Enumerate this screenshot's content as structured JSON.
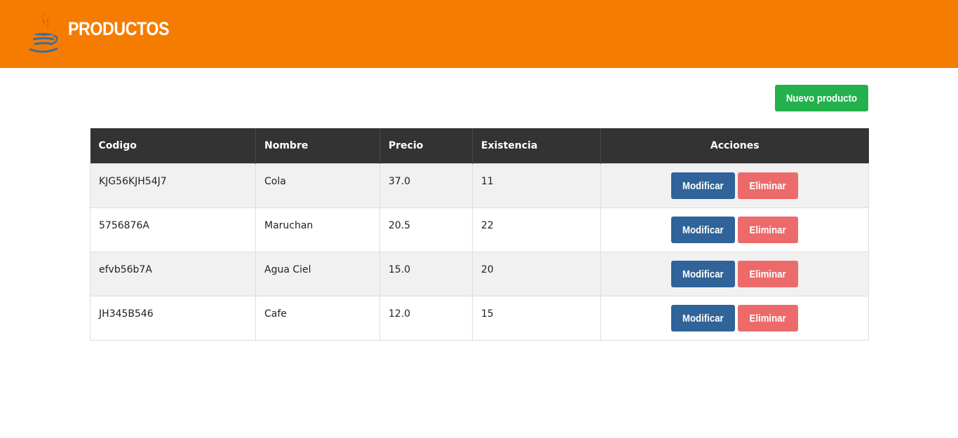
{
  "header": {
    "title": "PRODUCTOS",
    "logo_icon": "java-coffee-cup-icon",
    "background_color": "#f57c00"
  },
  "toolbar": {
    "new_product_label": "Nuevo producto",
    "new_product_color": "#22b14c"
  },
  "table": {
    "columns": [
      "Codigo",
      "Nombre",
      "Precio",
      "Existencia",
      "Acciones"
    ],
    "rows": [
      {
        "codigo": "KJG56KJH54J7",
        "nombre": "Cola",
        "precio": "37.0",
        "existencia": "11"
      },
      {
        "codigo": "5756876A",
        "nombre": "Maruchan",
        "precio": "20.5",
        "existencia": "22"
      },
      {
        "codigo": "efvb56b7A",
        "nombre": "Agua Ciel",
        "precio": "15.0",
        "existencia": "20"
      },
      {
        "codigo": "JH345B546",
        "nombre": "Cafe",
        "precio": "12.0",
        "existencia": "15"
      }
    ],
    "actions": {
      "edit_label": "Modificar",
      "delete_label": "Eliminar",
      "edit_color": "#2f6399",
      "delete_color": "#ec6a69"
    }
  }
}
